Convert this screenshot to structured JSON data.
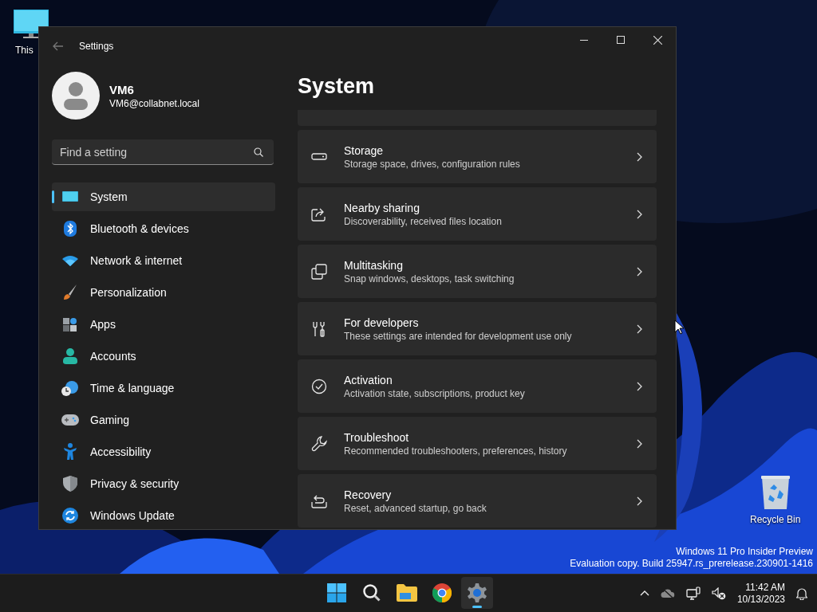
{
  "desktop": {
    "icons": [
      {
        "label": "This"
      },
      {
        "label": "Recycle Bin"
      }
    ],
    "watermark": [
      "Windows 11 Pro Insider Preview",
      "Evaluation copy. Build 25947.rs_prerelease.230901-1416"
    ]
  },
  "window": {
    "title": "Settings",
    "user": {
      "name": "VM6",
      "email": "VM6@collabnet.local"
    },
    "search": {
      "placeholder": "Find a setting"
    },
    "nav": [
      {
        "label": "System",
        "selected": true
      },
      {
        "label": "Bluetooth & devices",
        "selected": false
      },
      {
        "label": "Network & internet",
        "selected": false
      },
      {
        "label": "Personalization",
        "selected": false
      },
      {
        "label": "Apps",
        "selected": false
      },
      {
        "label": "Accounts",
        "selected": false
      },
      {
        "label": "Time & language",
        "selected": false
      },
      {
        "label": "Gaming",
        "selected": false
      },
      {
        "label": "Accessibility",
        "selected": false
      },
      {
        "label": "Privacy & security",
        "selected": false
      },
      {
        "label": "Windows Update",
        "selected": false
      }
    ],
    "heading": "System",
    "cards": [
      {
        "title": "Storage",
        "subtitle": "Storage space, drives, configuration rules"
      },
      {
        "title": "Nearby sharing",
        "subtitle": "Discoverability, received files location"
      },
      {
        "title": "Multitasking",
        "subtitle": "Snap windows, desktops, task switching"
      },
      {
        "title": "For developers",
        "subtitle": "These settings are intended for development use only"
      },
      {
        "title": "Activation",
        "subtitle": "Activation state, subscriptions, product key"
      },
      {
        "title": "Troubleshoot",
        "subtitle": "Recommended troubleshooters, preferences, history"
      },
      {
        "title": "Recovery",
        "subtitle": "Reset, advanced startup, go back"
      }
    ]
  },
  "taskbar": {
    "apps": [
      {
        "selected": false
      },
      {
        "selected": false
      },
      {
        "selected": false
      },
      {
        "selected": false
      },
      {
        "selected": true
      }
    ],
    "time": "11:42 AM",
    "date": "10/13/2023"
  }
}
